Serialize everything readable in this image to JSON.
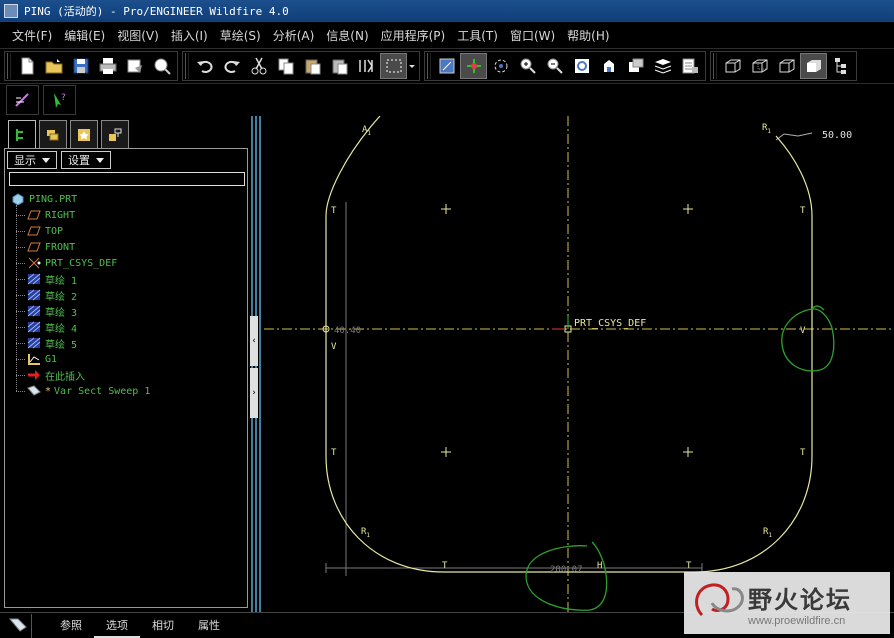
{
  "window": {
    "title": "PING (活动的) - Pro/ENGINEER Wildfire 4.0"
  },
  "menu": [
    {
      "label": "文件(F)"
    },
    {
      "label": "编辑(E)"
    },
    {
      "label": "视图(V)"
    },
    {
      "label": "插入(I)"
    },
    {
      "label": "草绘(S)"
    },
    {
      "label": "分析(A)"
    },
    {
      "label": "信息(N)"
    },
    {
      "label": "应用程序(P)"
    },
    {
      "label": "工具(T)"
    },
    {
      "label": "窗口(W)"
    },
    {
      "label": "帮助(H)"
    }
  ],
  "toolbar": {
    "file_group": [
      "new-file-icon",
      "open-folder-icon",
      "save-icon",
      "print-icon",
      "send-mail-icon",
      "mapkey-icon"
    ],
    "edit_group": [
      "undo-icon",
      "redo-icon",
      "cut-icon",
      "copy-icon",
      "paste-icon",
      "paste-special-icon",
      "regenerate-icon",
      "select-box-icon"
    ],
    "view_group": [
      "repaint-icon",
      "spin-center-icon",
      "orient-mode-icon",
      "zoom-in-icon",
      "zoom-out-icon",
      "refit-icon",
      "reorient-icon",
      "saved-views-icon",
      "layers-icon",
      "view-manager-icon"
    ],
    "display_group": [
      "wireframe-icon",
      "hidden-line-icon",
      "no-hidden-icon",
      "shading-icon",
      "model-tree-icon"
    ]
  },
  "navigator": {
    "show_label": "显示",
    "settings_label": "设置",
    "tree": [
      {
        "label": "PING.PRT",
        "kind": "part"
      },
      {
        "label": "RIGHT",
        "kind": "datum-plane"
      },
      {
        "label": "TOP",
        "kind": "datum-plane"
      },
      {
        "label": "FRONT",
        "kind": "datum-plane"
      },
      {
        "label": "PRT_CSYS_DEF",
        "kind": "csys"
      },
      {
        "label": "草绘 1",
        "kind": "sketch"
      },
      {
        "label": "草绘 2",
        "kind": "sketch"
      },
      {
        "label": "草绘 3",
        "kind": "sketch"
      },
      {
        "label": "草绘 4",
        "kind": "sketch"
      },
      {
        "label": "草绘 5",
        "kind": "sketch"
      },
      {
        "label": "G1",
        "kind": "graph"
      },
      {
        "label": "在此插入",
        "kind": "insert-here"
      },
      {
        "label": "Var Sect Sweep 1",
        "kind": "sweep"
      }
    ]
  },
  "sketch": {
    "csys_label": "PRT_CSYS_DEF",
    "dim_radius": "50.00",
    "dim_bottom": "200.07",
    "dim_left": "40.40",
    "marker_r1": "R",
    "marker_r1_sub": "1",
    "marker_a1": "A",
    "marker_a1_sub": "1",
    "marker_t": "T",
    "marker_h": "H",
    "marker_v": "V",
    "colors": {
      "sketch_line": "#e8e8a0",
      "centerline": "#d4c04a",
      "dimension": "#b0b0b0",
      "annotation": "#2fa02f"
    }
  },
  "dashboard": {
    "tabs": [
      {
        "label": "参照"
      },
      {
        "label": "选项"
      },
      {
        "label": "相切"
      },
      {
        "label": "属性"
      }
    ]
  },
  "watermark": {
    "title": "野火论坛",
    "url": "www.proewildfire.cn"
  }
}
